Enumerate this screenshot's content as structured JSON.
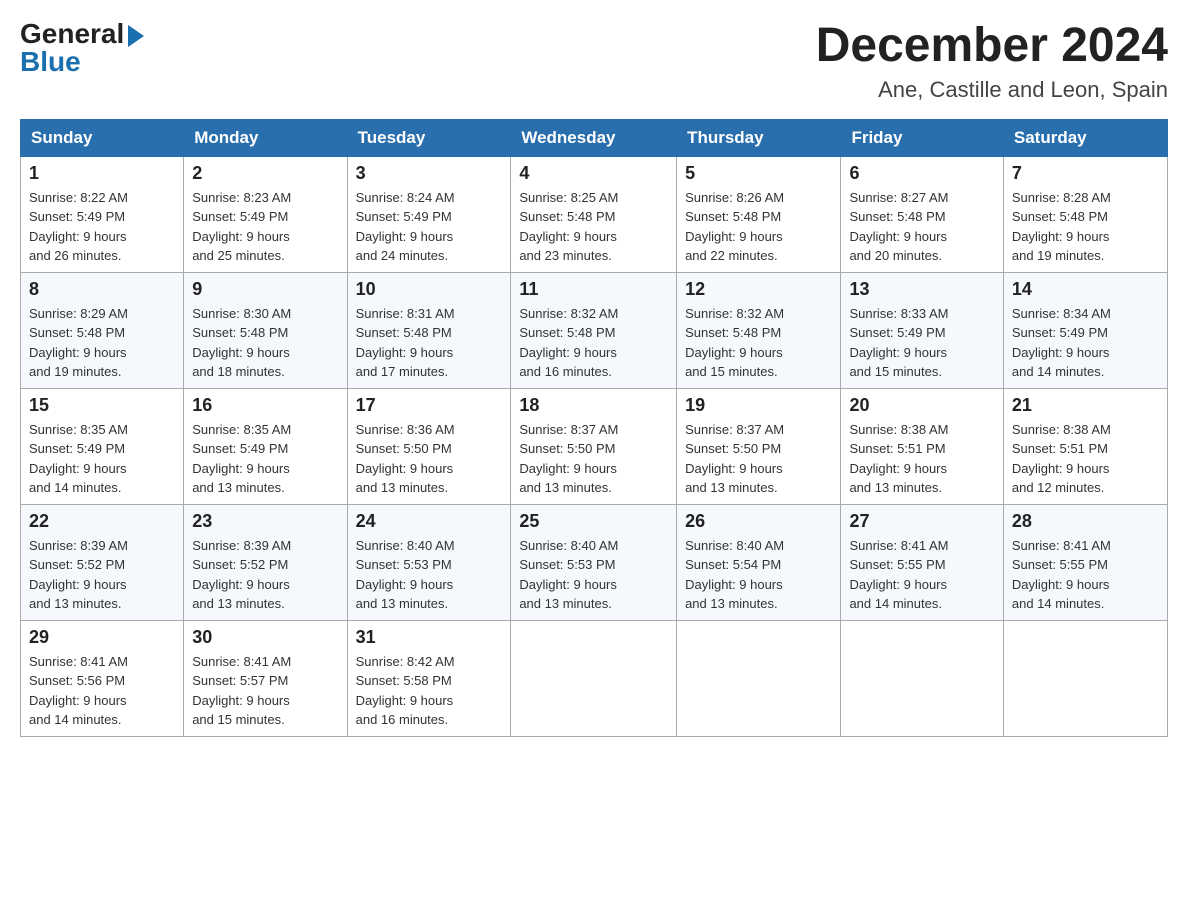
{
  "logo": {
    "general": "General",
    "blue": "Blue"
  },
  "title": "December 2024",
  "location": "Ane, Castille and Leon, Spain",
  "headers": [
    "Sunday",
    "Monday",
    "Tuesday",
    "Wednesday",
    "Thursday",
    "Friday",
    "Saturday"
  ],
  "weeks": [
    [
      {
        "day": "1",
        "sunrise": "8:22 AM",
        "sunset": "5:49 PM",
        "daylight": "9 hours and 26 minutes."
      },
      {
        "day": "2",
        "sunrise": "8:23 AM",
        "sunset": "5:49 PM",
        "daylight": "9 hours and 25 minutes."
      },
      {
        "day": "3",
        "sunrise": "8:24 AM",
        "sunset": "5:49 PM",
        "daylight": "9 hours and 24 minutes."
      },
      {
        "day": "4",
        "sunrise": "8:25 AM",
        "sunset": "5:48 PM",
        "daylight": "9 hours and 23 minutes."
      },
      {
        "day": "5",
        "sunrise": "8:26 AM",
        "sunset": "5:48 PM",
        "daylight": "9 hours and 22 minutes."
      },
      {
        "day": "6",
        "sunrise": "8:27 AM",
        "sunset": "5:48 PM",
        "daylight": "9 hours and 20 minutes."
      },
      {
        "day": "7",
        "sunrise": "8:28 AM",
        "sunset": "5:48 PM",
        "daylight": "9 hours and 19 minutes."
      }
    ],
    [
      {
        "day": "8",
        "sunrise": "8:29 AM",
        "sunset": "5:48 PM",
        "daylight": "9 hours and 19 minutes."
      },
      {
        "day": "9",
        "sunrise": "8:30 AM",
        "sunset": "5:48 PM",
        "daylight": "9 hours and 18 minutes."
      },
      {
        "day": "10",
        "sunrise": "8:31 AM",
        "sunset": "5:48 PM",
        "daylight": "9 hours and 17 minutes."
      },
      {
        "day": "11",
        "sunrise": "8:32 AM",
        "sunset": "5:48 PM",
        "daylight": "9 hours and 16 minutes."
      },
      {
        "day": "12",
        "sunrise": "8:32 AM",
        "sunset": "5:48 PM",
        "daylight": "9 hours and 15 minutes."
      },
      {
        "day": "13",
        "sunrise": "8:33 AM",
        "sunset": "5:49 PM",
        "daylight": "9 hours and 15 minutes."
      },
      {
        "day": "14",
        "sunrise": "8:34 AM",
        "sunset": "5:49 PM",
        "daylight": "9 hours and 14 minutes."
      }
    ],
    [
      {
        "day": "15",
        "sunrise": "8:35 AM",
        "sunset": "5:49 PM",
        "daylight": "9 hours and 14 minutes."
      },
      {
        "day": "16",
        "sunrise": "8:35 AM",
        "sunset": "5:49 PM",
        "daylight": "9 hours and 13 minutes."
      },
      {
        "day": "17",
        "sunrise": "8:36 AM",
        "sunset": "5:50 PM",
        "daylight": "9 hours and 13 minutes."
      },
      {
        "day": "18",
        "sunrise": "8:37 AM",
        "sunset": "5:50 PM",
        "daylight": "9 hours and 13 minutes."
      },
      {
        "day": "19",
        "sunrise": "8:37 AM",
        "sunset": "5:50 PM",
        "daylight": "9 hours and 13 minutes."
      },
      {
        "day": "20",
        "sunrise": "8:38 AM",
        "sunset": "5:51 PM",
        "daylight": "9 hours and 13 minutes."
      },
      {
        "day": "21",
        "sunrise": "8:38 AM",
        "sunset": "5:51 PM",
        "daylight": "9 hours and 12 minutes."
      }
    ],
    [
      {
        "day": "22",
        "sunrise": "8:39 AM",
        "sunset": "5:52 PM",
        "daylight": "9 hours and 13 minutes."
      },
      {
        "day": "23",
        "sunrise": "8:39 AM",
        "sunset": "5:52 PM",
        "daylight": "9 hours and 13 minutes."
      },
      {
        "day": "24",
        "sunrise": "8:40 AM",
        "sunset": "5:53 PM",
        "daylight": "9 hours and 13 minutes."
      },
      {
        "day": "25",
        "sunrise": "8:40 AM",
        "sunset": "5:53 PM",
        "daylight": "9 hours and 13 minutes."
      },
      {
        "day": "26",
        "sunrise": "8:40 AM",
        "sunset": "5:54 PM",
        "daylight": "9 hours and 13 minutes."
      },
      {
        "day": "27",
        "sunrise": "8:41 AM",
        "sunset": "5:55 PM",
        "daylight": "9 hours and 14 minutes."
      },
      {
        "day": "28",
        "sunrise": "8:41 AM",
        "sunset": "5:55 PM",
        "daylight": "9 hours and 14 minutes."
      }
    ],
    [
      {
        "day": "29",
        "sunrise": "8:41 AM",
        "sunset": "5:56 PM",
        "daylight": "9 hours and 14 minutes."
      },
      {
        "day": "30",
        "sunrise": "8:41 AM",
        "sunset": "5:57 PM",
        "daylight": "9 hours and 15 minutes."
      },
      {
        "day": "31",
        "sunrise": "8:42 AM",
        "sunset": "5:58 PM",
        "daylight": "9 hours and 16 minutes."
      },
      null,
      null,
      null,
      null
    ]
  ]
}
